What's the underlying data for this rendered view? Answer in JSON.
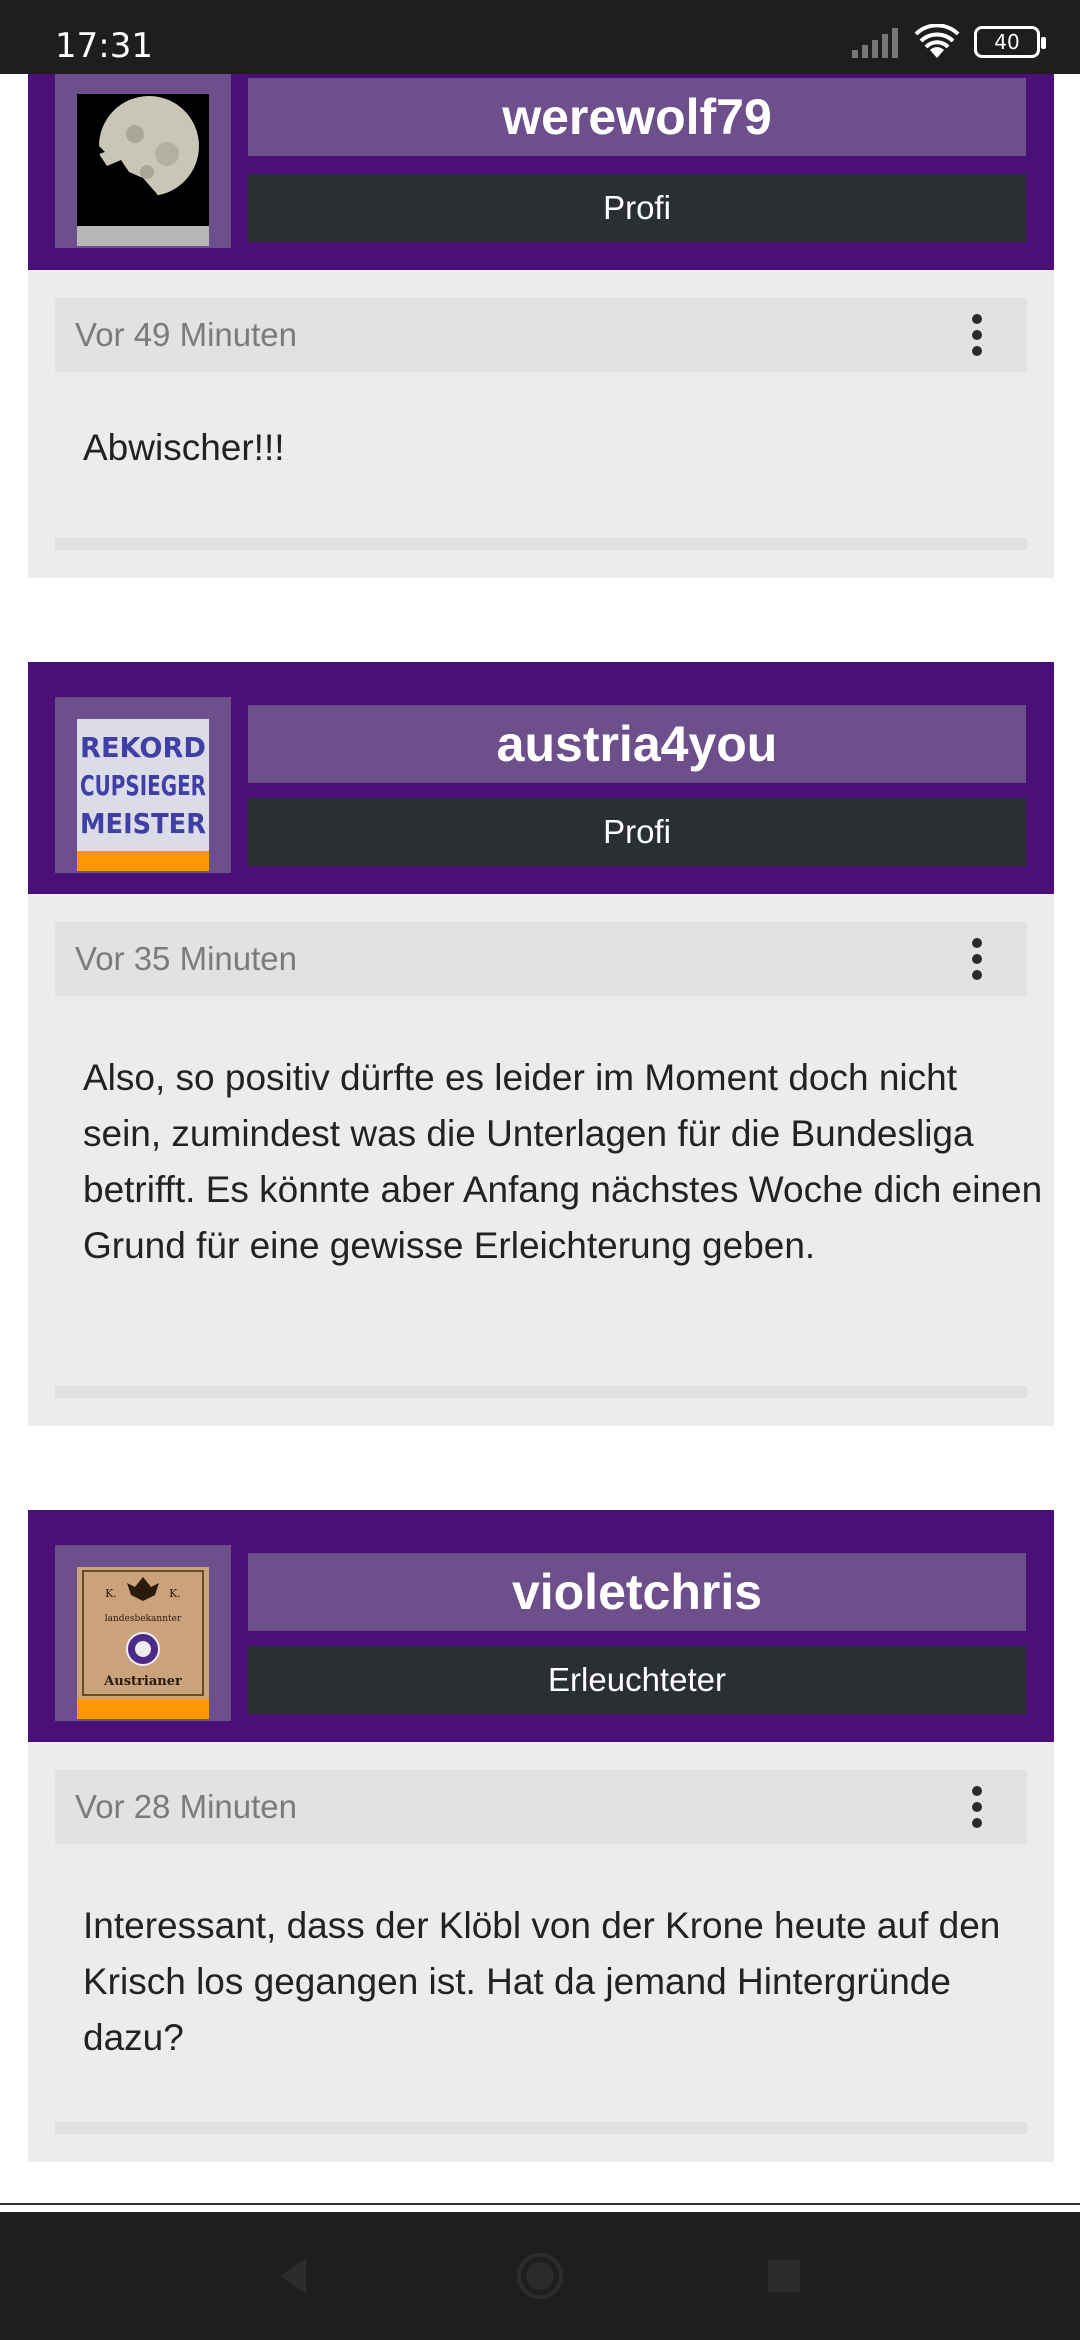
{
  "status_bar": {
    "time": "17:31",
    "battery": "40",
    "icons": [
      "signal-icon",
      "wifi-icon",
      "battery-icon"
    ]
  },
  "posts": [
    {
      "username": "werewolf79",
      "rank": "Profi",
      "time": "Vor 49 Minuten",
      "message": "Abwischer!!!",
      "avatar": "wolf-moon-avatar"
    },
    {
      "username": "austria4you",
      "rank": "Profi",
      "time": "Vor 35 Minuten",
      "message": "Also, so positiv dürfte es leider im Moment doch nicht sein, zumindest was die Unterlagen für die Bundesliga betrifft. Es könnte aber Anfang nächstes Woche dich einen Grund für eine gewisse Erleichterung geben.",
      "avatar": "rekord-cupsieger-meister-avatar",
      "avatar_text": [
        "REKORD",
        "CUPSIEGER",
        "MEISTER"
      ]
    },
    {
      "username": "violetchris",
      "rank": "Erleuchteter",
      "time": "Vor 28 Minuten",
      "message": "Interessant, dass der Klöbl von der Krone heute auf den Krisch los gegangen ist. Hat da jemand Hintergründe dazu?",
      "avatar": "austrianer-crest-avatar",
      "avatar_text": [
        "K.",
        "K.",
        "landesbekannter",
        "Austrianer"
      ]
    }
  ],
  "colors": {
    "header_bg": "#4b0f78",
    "name_box_bg": "#6d4f8c",
    "rank_box_bg": "#2b2e32",
    "body_bg": "#ececec",
    "accent_orange": "#ff9800"
  },
  "nav": [
    "back-icon",
    "home-icon",
    "recents-icon"
  ]
}
